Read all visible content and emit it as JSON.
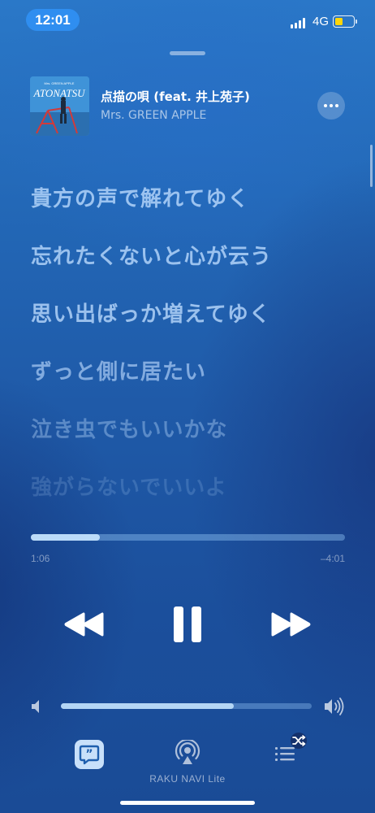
{
  "status_bar": {
    "time": "12:01",
    "network": "4G"
  },
  "now_playing": {
    "title": "点描の唄 (feat. 井上苑子)",
    "artist": "Mrs. GREEN APPLE",
    "artwork_text": "ATONATSU"
  },
  "lyrics": [
    "貴方の声で解れてゆく",
    "忘れたくないと心が云う",
    "思い出ばっか増えてゆく",
    "ずっと側に居たい",
    "泣き虫でもいいかな",
    "強がらないでいいよ"
  ],
  "playback": {
    "elapsed": "1:06",
    "remaining": "–4:01",
    "progress": 0.22,
    "volume": 0.69,
    "state": "playing"
  },
  "bottom_bar": {
    "airplay_label": "RAKU NAVI Lite"
  },
  "colors": {
    "time_pill": "#2f8ef0",
    "battery": "#ffd60a",
    "background_top": "#2a78c8",
    "background_bottom": "#1a4b96"
  },
  "icons": {
    "more": "ellipsis-icon",
    "rewind": "rewind-icon",
    "pause": "pause-icon",
    "forward": "fast-forward-icon",
    "volume_low": "speaker-low-icon",
    "volume_high": "speaker-high-icon",
    "lyrics": "lyrics-quote-icon",
    "airplay": "airplay-icon",
    "queue": "queue-list-icon",
    "shuffle": "shuffle-icon"
  }
}
